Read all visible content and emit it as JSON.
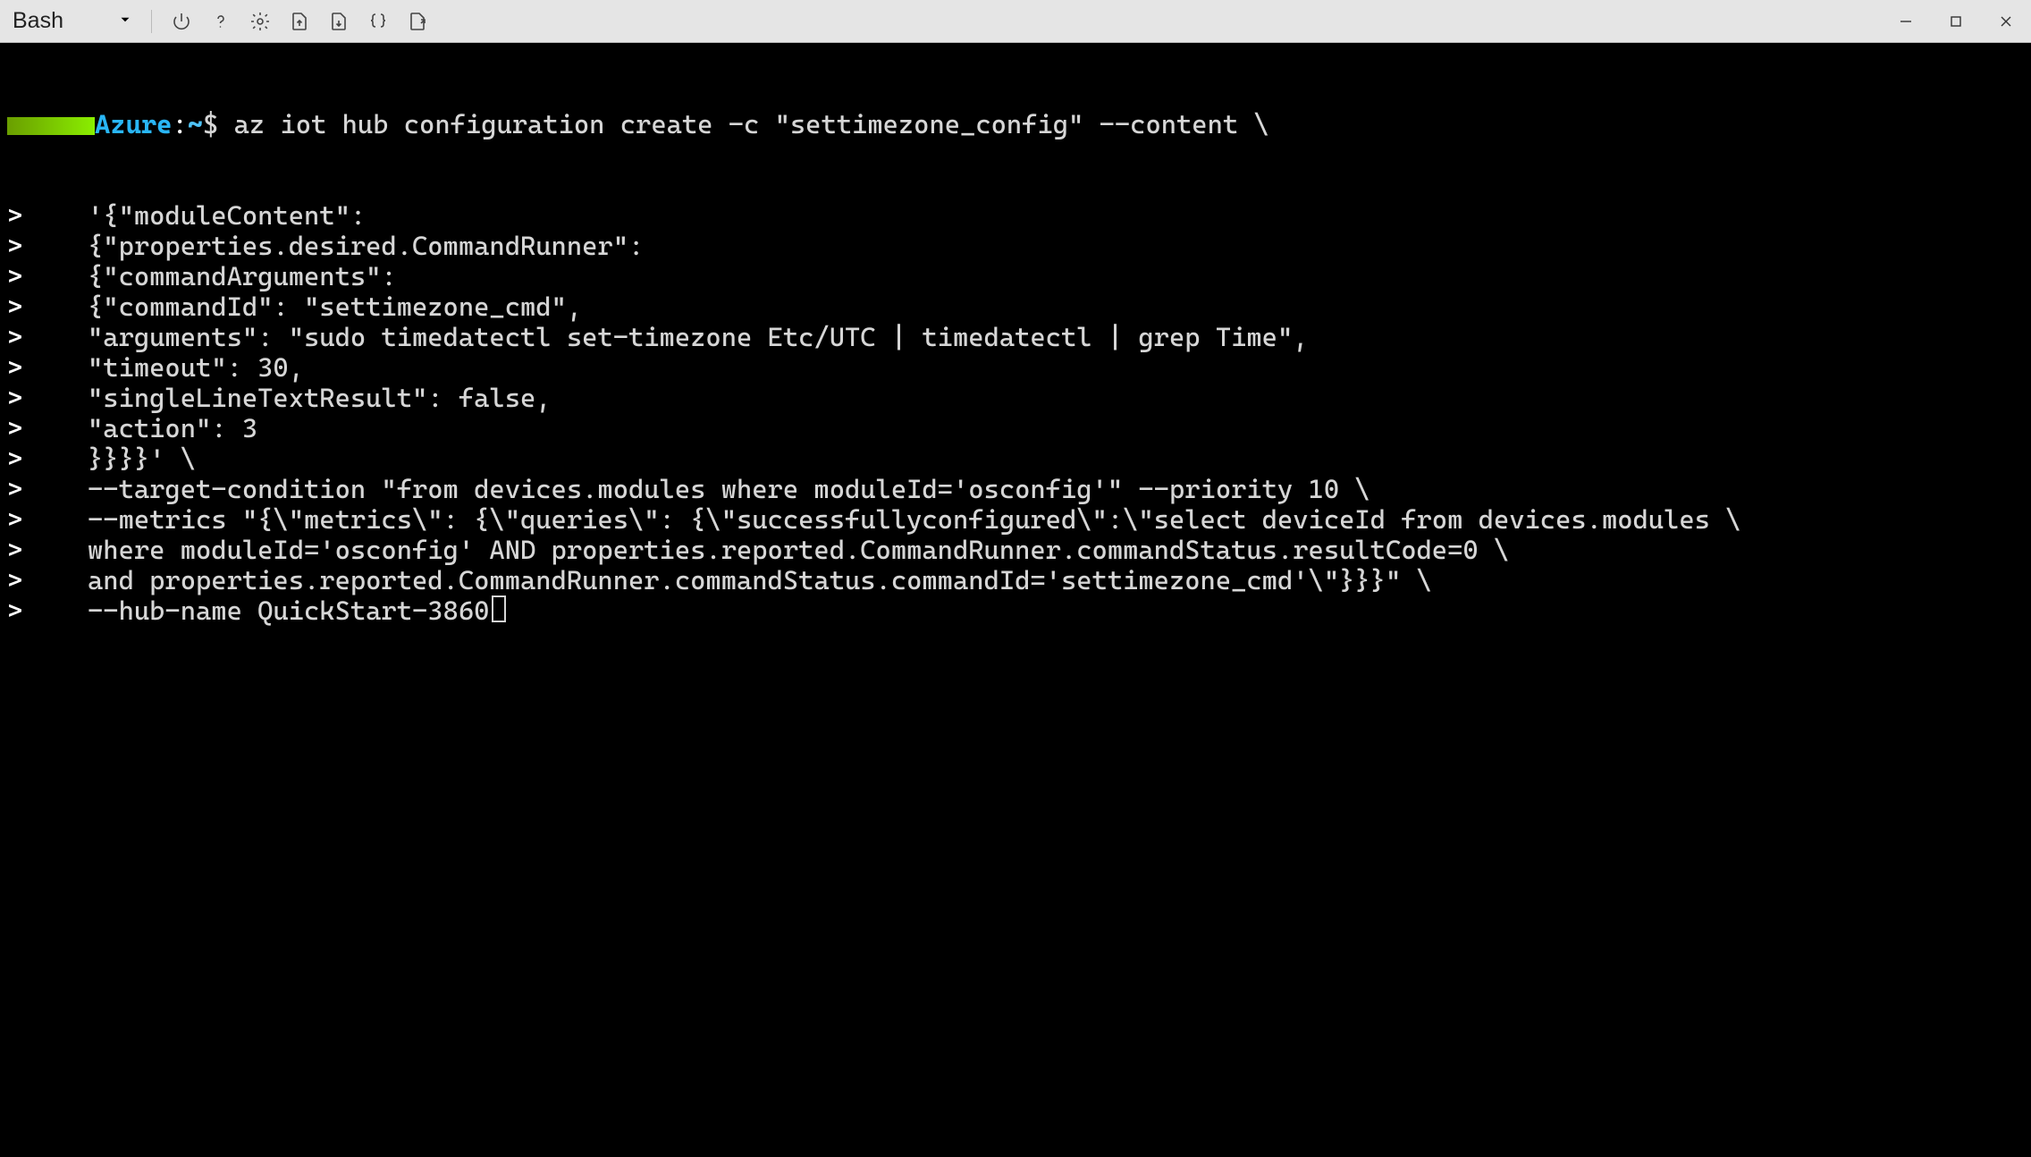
{
  "toolbar": {
    "shell_label": "Bash"
  },
  "prompt": {
    "host": "Azure",
    "separator": ":",
    "path": "~",
    "sigil": "$"
  },
  "command_first": "az iot hub configuration create -c \"settimezone_config\" --content \\",
  "continuation_lines": [
    "'{\"moduleContent\":",
    "{\"properties.desired.CommandRunner\":",
    "{\"commandArguments\":",
    "{\"commandId\": \"settimezone_cmd\",",
    "\"arguments\": \"sudo timedatectl set-timezone Etc/UTC | timedatectl | grep Time\",",
    "\"timeout\": 30,",
    "\"singleLineTextResult\": false,",
    "\"action\": 3",
    "}}}}' \\",
    "--target-condition \"from devices.modules where moduleId='osconfig'\" --priority 10 \\",
    "--metrics \"{\\\"metrics\\\": {\\\"queries\\\": {\\\"successfullyconfigured\\\":\\\"select deviceId from devices.modules \\",
    "where moduleId='osconfig' AND properties.reported.CommandRunner.commandStatus.resultCode=0 \\",
    "and properties.reported.CommandRunner.commandStatus.commandId='settimezone_cmd'\\\"}}}\" \\",
    "--hub-name QuickStart-3860"
  ]
}
